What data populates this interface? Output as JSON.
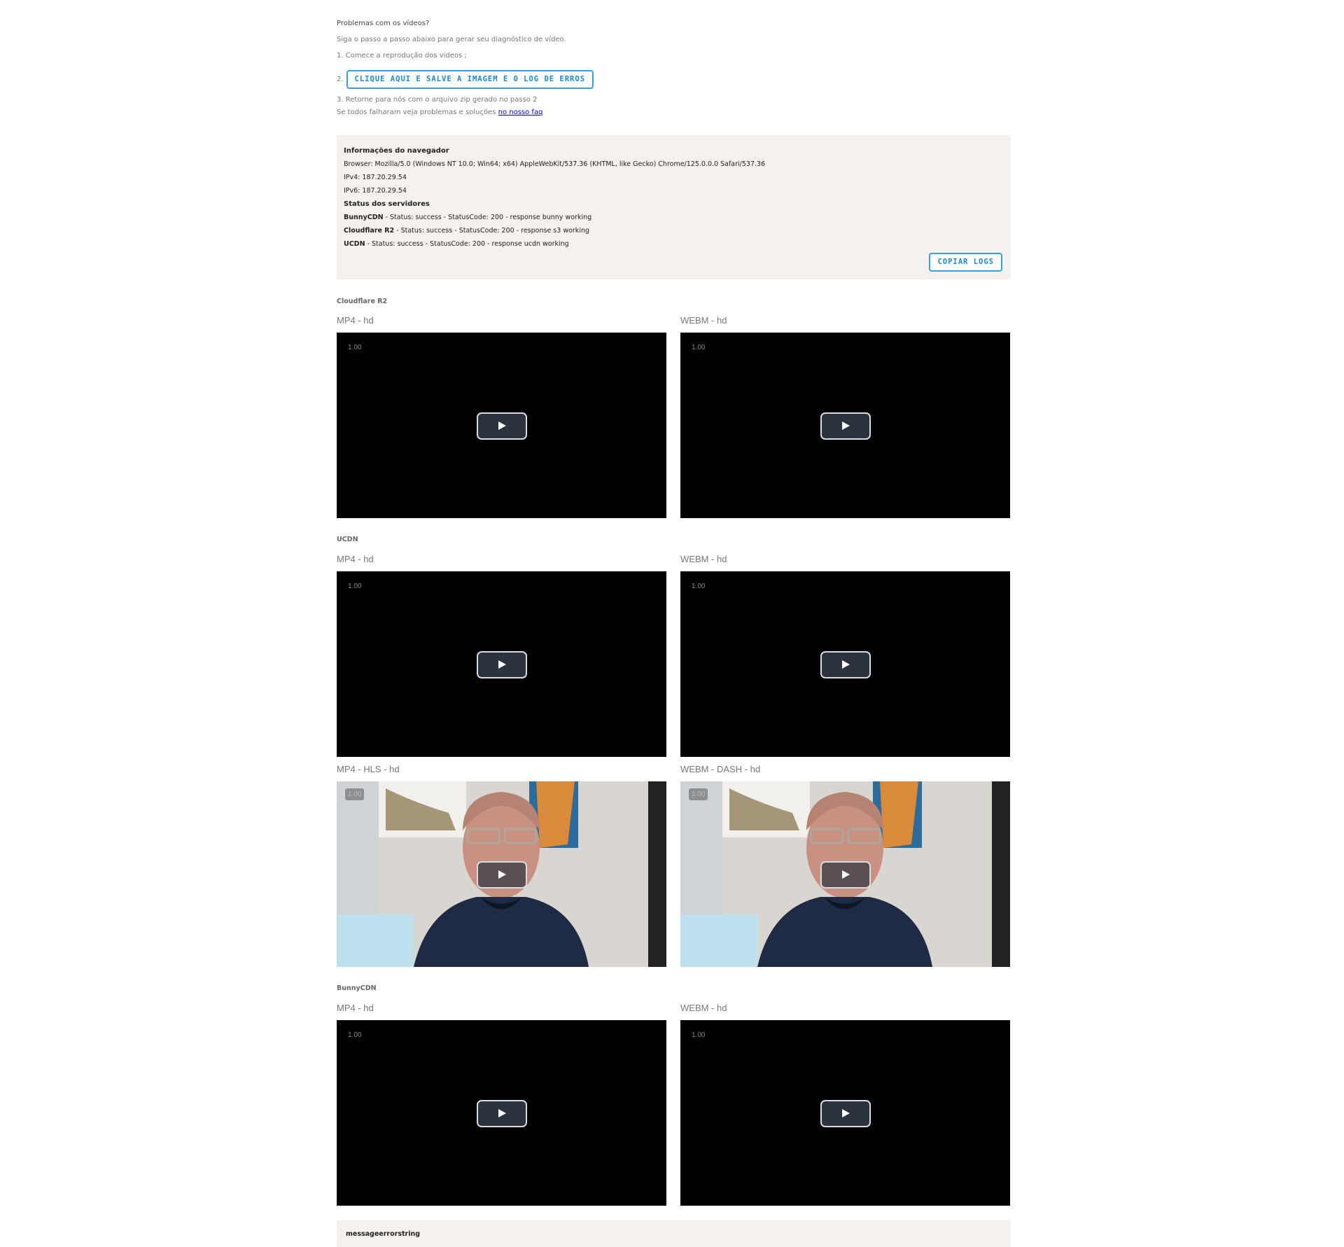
{
  "intro": {
    "title": "Problemas com os vídeos?",
    "subtitle": "Siga o passo a passo abaixo para gerar seu diagnóstico de vídeo.",
    "step1": "1. Comece a reprodução dos videos ;",
    "step2_num": "2.",
    "step2_button": "CLIQUE AQUI E SALVE A IMAGEM E O LOG DE ERROS",
    "step3": "3. Retorne para nós com o arquivo zip gerado no passo 2",
    "faq_prefix": "Se todos falharam veja problemas e soluções ",
    "faq_link": "no nosso faq"
  },
  "info": {
    "browser_header": "Informações do navegador",
    "browser": "Browser: Mozilla/5.0 (Windows NT 10.0; Win64; x64) AppleWebKit/537.36 (KHTML, like Gecko) Chrome/125.0.0.0 Safari/537.36",
    "ipv4": "IPv4: 187.20.29.54",
    "ipv6": "IPv6: 187.20.29.54",
    "servers_header": "Status dos servidores",
    "servers": [
      {
        "name": "BunnyCDN",
        "status": " - Status: success - StatusCode: 200 - response bunny working"
      },
      {
        "name": "Cloudflare R2",
        "status": " - Status: success - StatusCode: 200 - response s3 working"
      },
      {
        "name": "UCDN",
        "status": " - Status: success - StatusCode: 200 - response ucdn working"
      }
    ],
    "copy_button": "COPIAR LOGS"
  },
  "sections": {
    "cloudflare": {
      "title": "Cloudflare R2",
      "left_label": "MP4 - hd",
      "right_label": "WEBM - hd"
    },
    "ucdn": {
      "title": "UCDN",
      "left_label": "MP4 - hd",
      "right_label": "WEBM - hd",
      "left2_label": "MP4 - HLS - hd",
      "right2_label": "WEBM - DASH - hd"
    },
    "bunny": {
      "title": "BunnyCDN",
      "left_label": "MP4 - hd",
      "right_label": "WEBM - hd"
    }
  },
  "player": {
    "rate": "1.00",
    "play_icon": "play-icon"
  },
  "error": {
    "message": "messageerrorstring"
  },
  "colors": {
    "accent": "#1a88d3",
    "box_bg": "#f4f1ee",
    "player_bg": "#000000"
  }
}
